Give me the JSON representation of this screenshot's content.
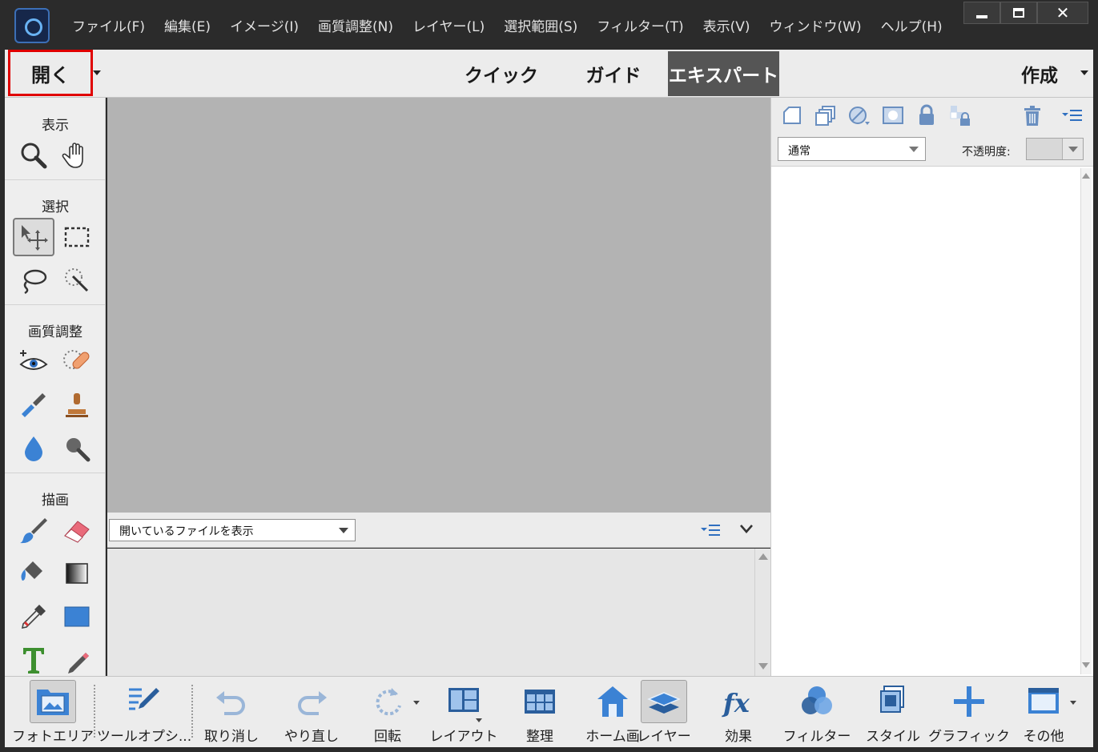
{
  "menu": {
    "items": [
      "ファイル(F)",
      "編集(E)",
      "イメージ(I)",
      "画質調整(N)",
      "レイヤー(L)",
      "選択範囲(S)",
      "フィルター(T)",
      "表示(V)",
      "ウィンドウ(W)",
      "ヘルプ(H)"
    ]
  },
  "window_controls": {
    "close_glyph": "✕"
  },
  "modebar": {
    "open_label": "開く",
    "tabs": [
      {
        "label": "クイック",
        "active": false
      },
      {
        "label": "ガイド",
        "active": false
      },
      {
        "label": "エキスパート",
        "active": true
      }
    ],
    "create_label": "作成"
  },
  "tools": {
    "groups": [
      "表示",
      "選択",
      "画質調整",
      "描画"
    ],
    "icons": {
      "zoom": "zoom-icon",
      "hand": "hand-icon",
      "move": "move-tool-icon",
      "marquee": "marquee-icon",
      "lasso": "lasso-icon",
      "quick_select": "quick-selection-icon",
      "red_eye": "red-eye-icon",
      "healing": "spot-healing-icon",
      "smart_brush": "smart-brush-icon",
      "clone": "clone-stamp-icon",
      "blur": "blur-icon",
      "sponge": "sponge-icon",
      "brush": "brush-icon",
      "eraser": "eraser-icon",
      "paint_bucket": "paint-bucket-icon",
      "gradient": "gradient-icon",
      "eyedropper": "eyedropper-icon",
      "shape": "rectangle-shape-icon",
      "type": "type-tool-icon",
      "pencil": "pencil-icon"
    }
  },
  "bin": {
    "select_value": "開いているファイルを表示"
  },
  "layers": {
    "blend_mode": "通常",
    "opacity_label": "不透明度:"
  },
  "taskbar": {
    "items": [
      {
        "label": "フォトエリア",
        "active": true
      },
      {
        "label": "ツールオプシ...",
        "active": false
      },
      {
        "label": "取り消し",
        "active": false
      },
      {
        "label": "やり直し",
        "active": false
      },
      {
        "label": "回転",
        "active": false
      },
      {
        "label": "レイアウト",
        "active": false
      },
      {
        "label": "整理",
        "active": false
      },
      {
        "label": "ホーム画",
        "active": false
      },
      {
        "label": "レイヤー",
        "active": true
      },
      {
        "label": "効果",
        "active": false
      },
      {
        "label": "フィルター",
        "active": false
      },
      {
        "label": "スタイル",
        "active": false
      },
      {
        "label": "グラフィック",
        "active": false
      },
      {
        "label": "その他",
        "active": false
      }
    ]
  },
  "colors": {
    "menubar_bg": "#2b2b2b",
    "panel_bg": "#ececec",
    "canvas_bg": "#b3b3b3",
    "accent_blue": "#3b82d4",
    "highlight_red": "#e00000",
    "active_tab_bg": "#555555"
  }
}
